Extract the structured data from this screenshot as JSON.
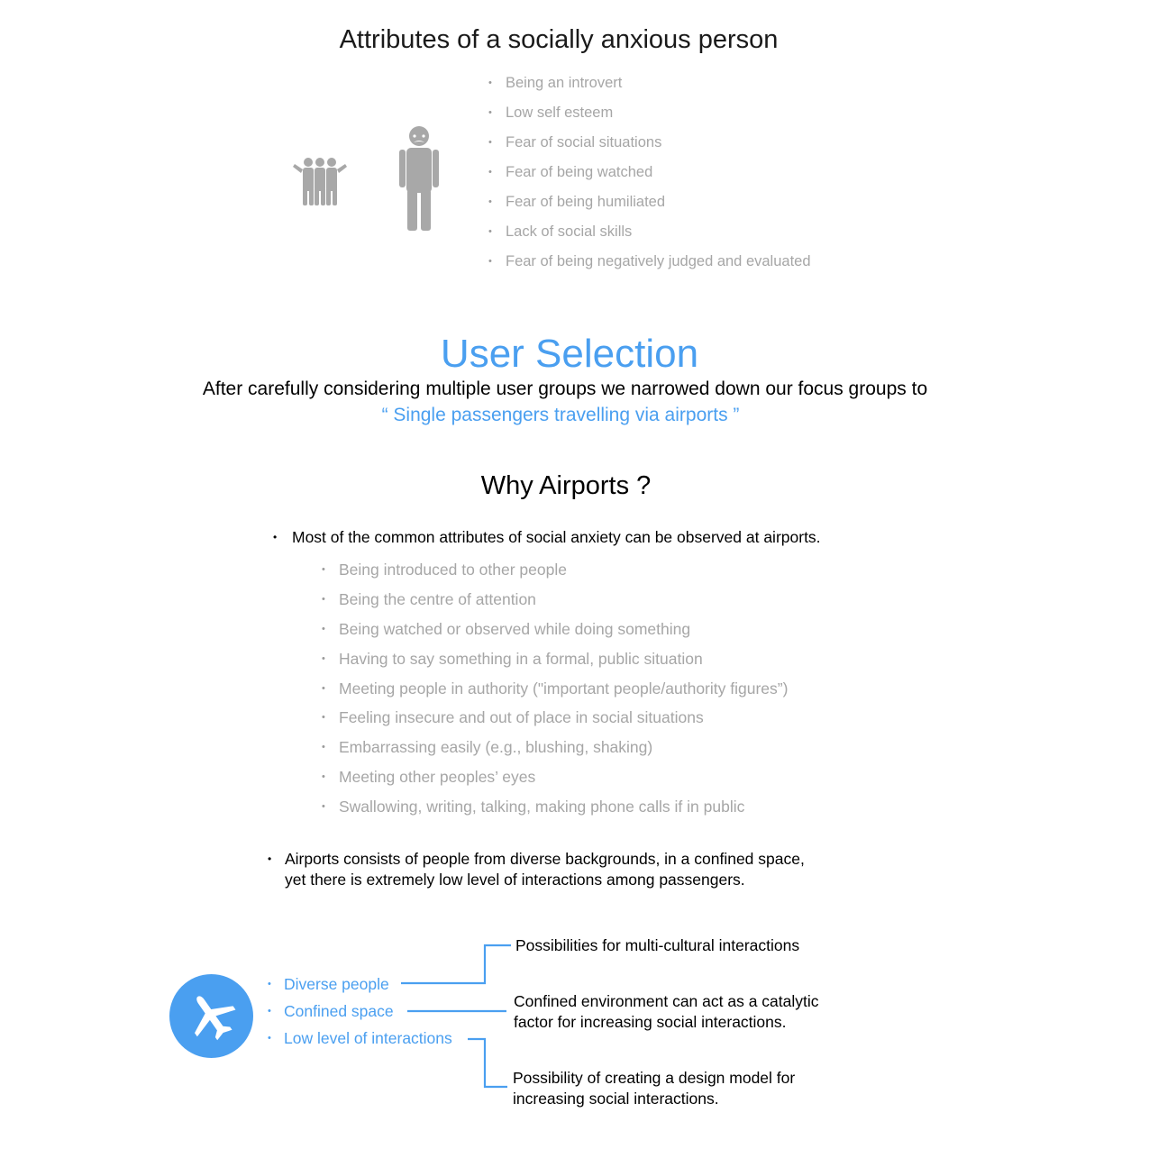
{
  "attributes": {
    "title": "Attributes of a socially anxious person",
    "items": [
      "Being an introvert",
      "Low self esteem",
      "Fear of social situations",
      "Fear of being watched",
      "Fear of being humiliated",
      "Lack of social skills",
      "Fear of being negatively judged and evaluated"
    ],
    "icons": [
      "group-of-people-icon",
      "person-icon"
    ]
  },
  "user_selection": {
    "title": "User Selection",
    "text": "After carefully considering multiple user groups we narrowed down our focus groups to",
    "quote": "“ Single passengers travelling via airports ”"
  },
  "why_airports": {
    "title": "Why Airports ?",
    "bullet1": "Most of the common attributes of social anxiety can be observed at airports.",
    "sub_items": [
      "Being introduced to other people",
      "Being the centre of attention",
      "Being watched or observed while doing something",
      "Having to say something in a formal, public situation",
      "Meeting people in authority (\"important people/authority figures”)",
      "Feeling insecure and out of place in social situations",
      "Embarrassing easily (e.g., blushing, shaking)",
      "Meeting other peoples’ eyes",
      "Swallowing, writing, talking, making phone calls if in public"
    ],
    "bullet2_line1": "Airports consists of people from diverse backgrounds, in a confined space,",
    "bullet2_line2": "yet there is extremely low level of interactions among passengers."
  },
  "factors": {
    "icon": "airplane-icon",
    "items": [
      "Diverse people",
      "Confined space",
      "Low level of interactions"
    ],
    "outcomes": [
      {
        "lines": [
          "Possibilities for multi-cultural interactions"
        ]
      },
      {
        "lines": [
          "Confined environment can act as a catalytic",
          "factor for increasing social interactions."
        ]
      },
      {
        "lines": [
          "Possibility of creating a design model for",
          "increasing social interactions."
        ]
      }
    ]
  },
  "colors": {
    "accent": "#4a9ff0",
    "muted_text": "#a6a6a6",
    "icon_grey": "#a8a8a8"
  }
}
